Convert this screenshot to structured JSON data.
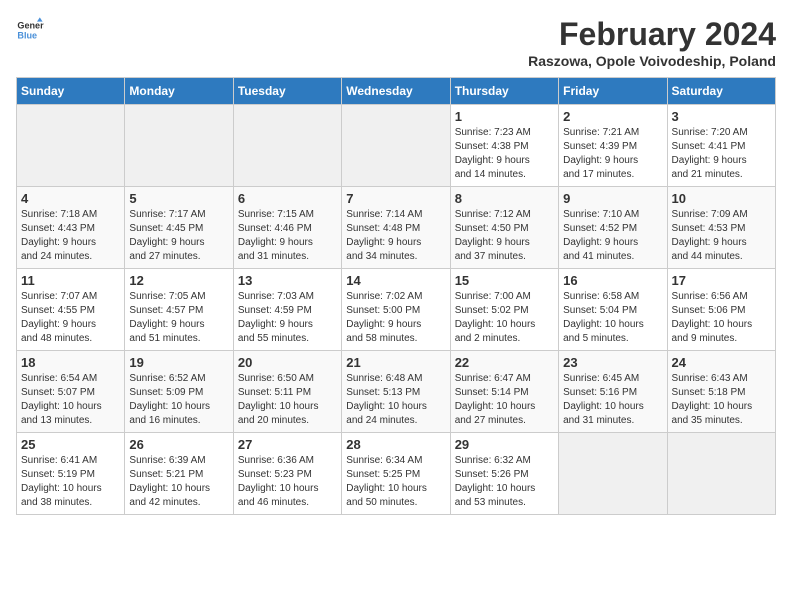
{
  "logo": {
    "general": "General",
    "blue": "Blue"
  },
  "header": {
    "month_year": "February 2024",
    "location": "Raszowa, Opole Voivodeship, Poland"
  },
  "days_of_week": [
    "Sunday",
    "Monday",
    "Tuesday",
    "Wednesday",
    "Thursday",
    "Friday",
    "Saturday"
  ],
  "weeks": [
    [
      {
        "day": "",
        "info": ""
      },
      {
        "day": "",
        "info": ""
      },
      {
        "day": "",
        "info": ""
      },
      {
        "day": "",
        "info": ""
      },
      {
        "day": "1",
        "info": "Sunrise: 7:23 AM\nSunset: 4:38 PM\nDaylight: 9 hours\nand 14 minutes."
      },
      {
        "day": "2",
        "info": "Sunrise: 7:21 AM\nSunset: 4:39 PM\nDaylight: 9 hours\nand 17 minutes."
      },
      {
        "day": "3",
        "info": "Sunrise: 7:20 AM\nSunset: 4:41 PM\nDaylight: 9 hours\nand 21 minutes."
      }
    ],
    [
      {
        "day": "4",
        "info": "Sunrise: 7:18 AM\nSunset: 4:43 PM\nDaylight: 9 hours\nand 24 minutes."
      },
      {
        "day": "5",
        "info": "Sunrise: 7:17 AM\nSunset: 4:45 PM\nDaylight: 9 hours\nand 27 minutes."
      },
      {
        "day": "6",
        "info": "Sunrise: 7:15 AM\nSunset: 4:46 PM\nDaylight: 9 hours\nand 31 minutes."
      },
      {
        "day": "7",
        "info": "Sunrise: 7:14 AM\nSunset: 4:48 PM\nDaylight: 9 hours\nand 34 minutes."
      },
      {
        "day": "8",
        "info": "Sunrise: 7:12 AM\nSunset: 4:50 PM\nDaylight: 9 hours\nand 37 minutes."
      },
      {
        "day": "9",
        "info": "Sunrise: 7:10 AM\nSunset: 4:52 PM\nDaylight: 9 hours\nand 41 minutes."
      },
      {
        "day": "10",
        "info": "Sunrise: 7:09 AM\nSunset: 4:53 PM\nDaylight: 9 hours\nand 44 minutes."
      }
    ],
    [
      {
        "day": "11",
        "info": "Sunrise: 7:07 AM\nSunset: 4:55 PM\nDaylight: 9 hours\nand 48 minutes."
      },
      {
        "day": "12",
        "info": "Sunrise: 7:05 AM\nSunset: 4:57 PM\nDaylight: 9 hours\nand 51 minutes."
      },
      {
        "day": "13",
        "info": "Sunrise: 7:03 AM\nSunset: 4:59 PM\nDaylight: 9 hours\nand 55 minutes."
      },
      {
        "day": "14",
        "info": "Sunrise: 7:02 AM\nSunset: 5:00 PM\nDaylight: 9 hours\nand 58 minutes."
      },
      {
        "day": "15",
        "info": "Sunrise: 7:00 AM\nSunset: 5:02 PM\nDaylight: 10 hours\nand 2 minutes."
      },
      {
        "day": "16",
        "info": "Sunrise: 6:58 AM\nSunset: 5:04 PM\nDaylight: 10 hours\nand 5 minutes."
      },
      {
        "day": "17",
        "info": "Sunrise: 6:56 AM\nSunset: 5:06 PM\nDaylight: 10 hours\nand 9 minutes."
      }
    ],
    [
      {
        "day": "18",
        "info": "Sunrise: 6:54 AM\nSunset: 5:07 PM\nDaylight: 10 hours\nand 13 minutes."
      },
      {
        "day": "19",
        "info": "Sunrise: 6:52 AM\nSunset: 5:09 PM\nDaylight: 10 hours\nand 16 minutes."
      },
      {
        "day": "20",
        "info": "Sunrise: 6:50 AM\nSunset: 5:11 PM\nDaylight: 10 hours\nand 20 minutes."
      },
      {
        "day": "21",
        "info": "Sunrise: 6:48 AM\nSunset: 5:13 PM\nDaylight: 10 hours\nand 24 minutes."
      },
      {
        "day": "22",
        "info": "Sunrise: 6:47 AM\nSunset: 5:14 PM\nDaylight: 10 hours\nand 27 minutes."
      },
      {
        "day": "23",
        "info": "Sunrise: 6:45 AM\nSunset: 5:16 PM\nDaylight: 10 hours\nand 31 minutes."
      },
      {
        "day": "24",
        "info": "Sunrise: 6:43 AM\nSunset: 5:18 PM\nDaylight: 10 hours\nand 35 minutes."
      }
    ],
    [
      {
        "day": "25",
        "info": "Sunrise: 6:41 AM\nSunset: 5:19 PM\nDaylight: 10 hours\nand 38 minutes."
      },
      {
        "day": "26",
        "info": "Sunrise: 6:39 AM\nSunset: 5:21 PM\nDaylight: 10 hours\nand 42 minutes."
      },
      {
        "day": "27",
        "info": "Sunrise: 6:36 AM\nSunset: 5:23 PM\nDaylight: 10 hours\nand 46 minutes."
      },
      {
        "day": "28",
        "info": "Sunrise: 6:34 AM\nSunset: 5:25 PM\nDaylight: 10 hours\nand 50 minutes."
      },
      {
        "day": "29",
        "info": "Sunrise: 6:32 AM\nSunset: 5:26 PM\nDaylight: 10 hours\nand 53 minutes."
      },
      {
        "day": "",
        "info": ""
      },
      {
        "day": "",
        "info": ""
      }
    ]
  ]
}
